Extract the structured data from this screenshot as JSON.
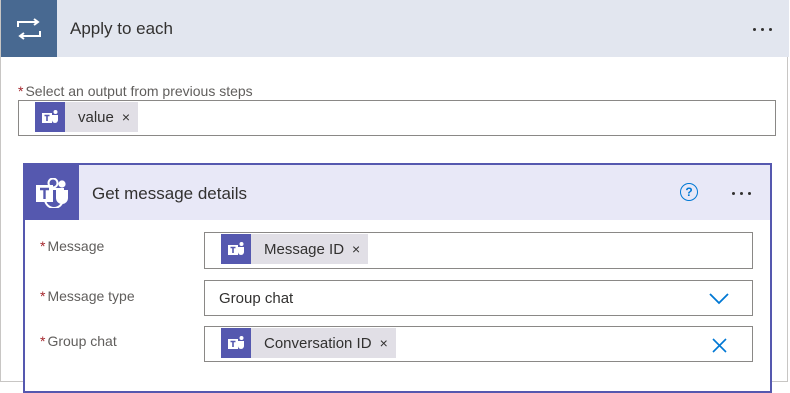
{
  "apply_each": {
    "title": "Apply to each",
    "icon": "loop-icon",
    "select_output_label": "Select an output from previous steps",
    "select_output_token": "value"
  },
  "action": {
    "title": "Get message details",
    "icon": "teams-icon",
    "fields": {
      "message": {
        "label": "Message",
        "token": "Message ID"
      },
      "message_type": {
        "label": "Message type",
        "value": "Group chat"
      },
      "group_chat": {
        "label": "Group chat",
        "token": "Conversation ID"
      }
    }
  },
  "required_marker": "*",
  "remove_glyph": "×",
  "colors": {
    "outer_header_bg": "#e2e6ef",
    "loop_icon_bg": "#486991",
    "teams_brand": "#5558af",
    "inner_header_bg": "#e8e8f7",
    "link_blue": "#0078d4",
    "required_red": "#a4262c"
  }
}
